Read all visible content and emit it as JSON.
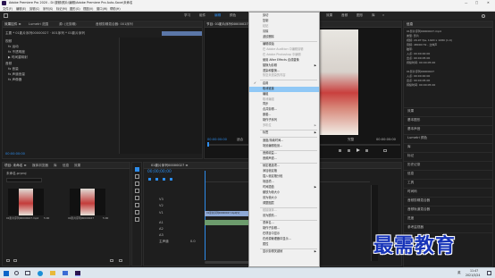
{
  "window": {
    "title": "Adobe Premiere Pro 2020 - D:\\视频\\照片\\编辑\\Adobe Premiere Pro Auto-Save\\未命名",
    "controls": [
      "—",
      "□",
      "✕"
    ]
  },
  "menu_bar": [
    "文件(F)",
    "编辑(E)",
    "剪辑(C)",
    "序列(S)",
    "标记(M)",
    "图形(G)",
    "视图(V)",
    "窗口(W)",
    "帮助(H)"
  ],
  "workspaces": [
    "学习",
    "组件",
    "编辑",
    "颜色",
    "效果",
    "音频",
    "图形",
    "库",
    "»"
  ],
  "source_panel": {
    "tabs": [
      "效果控件 ≡",
      "Lumetri 范围",
      "源: (无剪辑)",
      "音频剪辑混合器: 001序列"
    ],
    "header": "主要 * 01影片序列00000027 · 001序列 * 01影片序列",
    "rows": [
      "视频",
      "fx 运动",
      "fx 不透明度",
      "▶ 时间重映射",
      "音频",
      "fx 音量",
      "fx 声道音量",
      "fx 声像器"
    ],
    "timecode": "00:00:00:00"
  },
  "program_panel": {
    "tabs": [
      "节目: 01影片序列00000027.mp4 ≡"
    ],
    "timecode_left": "00:00:00:00",
    "fit": "适合",
    "quality": "完整",
    "timecode_right": "00:00:00:00"
  },
  "project_panel": {
    "tabs": [
      "项目: 未命名 ≡",
      "媒体浏览器",
      "库",
      "信息",
      "效果"
    ],
    "name": "未命名.prproj",
    "clips": [
      {
        "name": "01影片序列00000027.mp4",
        "dur": "5:00"
      },
      {
        "name": "01影片序列00000027",
        "dur": "5:00"
      }
    ]
  },
  "timeline_panel": {
    "tab": "01影片序列00000027 ≡",
    "timecode": "00;00;00;00",
    "tracks": [
      "V3",
      "V2",
      "V1",
      "A1",
      "A2",
      "A3",
      "主声道"
    ],
    "master_value": "0.0",
    "clip_v1": "01影片序列00000027.mp4[V]"
  },
  "right_panel": {
    "header": "信息",
    "info": [
      "01影片序列00000027.mp4",
      "类型: 影片",
      "视频: 29.97 fps, 1920 x 1080 (1.0)",
      "音频: 48000 Hz - 立体声",
      "磁带:",
      "入点: 00:00:00:00",
      "出点: 00:00:05:00",
      "持续时间: 00:00:05:00"
    ],
    "sub": [
      "01影片序列00000027",
      "入点: 00:00:00:00",
      "出点: 00:00:05:00",
      "持续时间: 00:00:05:00"
    ],
    "panels": [
      "效果",
      "基本图形",
      "基本声音",
      "Lumetri 颜色",
      "库",
      "标记",
      "历史记录",
      "信息",
      "工具",
      "时间码",
      "音频剪辑混合器",
      "音频轨道混合器",
      "进度",
      "参考监视器"
    ]
  },
  "context_menu": {
    "items": [
      {
        "label": "剪切",
        "state": "normal"
      },
      {
        "label": "复制",
        "state": "normal"
      },
      {
        "label": "粘贴",
        "state": "disabled"
      },
      {
        "label": "清除",
        "state": "normal"
      },
      {
        "label": "波纹删除",
        "state": "normal"
      },
      {
        "sep": true
      },
      {
        "label": "编辑原始",
        "state": "normal"
      },
      {
        "label": "在 Adobe Audition 中编辑剪辑",
        "state": "disabled"
      },
      {
        "label": "在 Adobe Photoshop 中编辑",
        "state": "disabled"
      },
      {
        "label": "使用 After Effects 合成替换",
        "state": "normal"
      },
      {
        "label": "替换为剪辑",
        "state": "normal",
        "submenu": true
      },
      {
        "label": "渲染和替换...",
        "state": "normal"
      },
      {
        "label": "恢复未渲染的内容",
        "state": "disabled"
      },
      {
        "sep": true
      },
      {
        "label": "启用",
        "state": "normal",
        "check": true
      },
      {
        "label": "取消链接",
        "state": "highlight"
      },
      {
        "label": "编组",
        "state": "normal"
      },
      {
        "label": "取消编组",
        "state": "disabled"
      },
      {
        "label": "同步",
        "state": "normal"
      },
      {
        "label": "合并剪辑...",
        "state": "normal"
      },
      {
        "label": "嵌套...",
        "state": "normal"
      },
      {
        "label": "制作子序列",
        "state": "normal"
      },
      {
        "label": "多机位",
        "state": "disabled",
        "submenu": true
      },
      {
        "sep": true
      },
      {
        "label": "标签",
        "state": "normal",
        "submenu": true
      },
      {
        "sep": true
      },
      {
        "label": "速度/持续时间...",
        "state": "normal"
      },
      {
        "label": "场景编辑检测...",
        "state": "normal"
      },
      {
        "sep": true
      },
      {
        "label": "音频增益...",
        "state": "normal"
      },
      {
        "label": "音频声道...",
        "state": "normal"
      },
      {
        "sep": true
      },
      {
        "label": "帧定格选项...",
        "state": "normal"
      },
      {
        "label": "添加帧定格",
        "state": "normal"
      },
      {
        "label": "插入帧定格分段",
        "state": "normal"
      },
      {
        "label": "场选项...",
        "state": "normal"
      },
      {
        "label": "时间插值",
        "state": "normal",
        "submenu": true
      },
      {
        "label": "缩放为帧大小",
        "state": "normal"
      },
      {
        "label": "设为帧大小",
        "state": "normal"
      },
      {
        "label": "调整图层",
        "state": "normal"
      },
      {
        "sep": true
      },
      {
        "label": "链接媒体...",
        "state": "disabled"
      },
      {
        "label": "设为脱机...",
        "state": "normal"
      },
      {
        "sep": true
      },
      {
        "label": "重命名...",
        "state": "normal"
      },
      {
        "label": "制作子剪辑...",
        "state": "normal"
      },
      {
        "label": "在项目中显示",
        "state": "normal"
      },
      {
        "label": "在资源管理器中显示...",
        "state": "normal"
      },
      {
        "label": "属性",
        "state": "normal"
      },
      {
        "sep": true
      },
      {
        "label": "显示剪辑关键帧",
        "state": "normal",
        "submenu": true
      }
    ]
  },
  "taskbar": {
    "time": "11:47",
    "date": "2021/3/24",
    "lang": "英"
  },
  "watermark": "最需教育",
  "colors": {
    "menu_highlight": "#90c8f6",
    "accent_blue": "#2d8ceb",
    "clip_blue": "#8ea9d6",
    "watermark": "#1633b8"
  }
}
